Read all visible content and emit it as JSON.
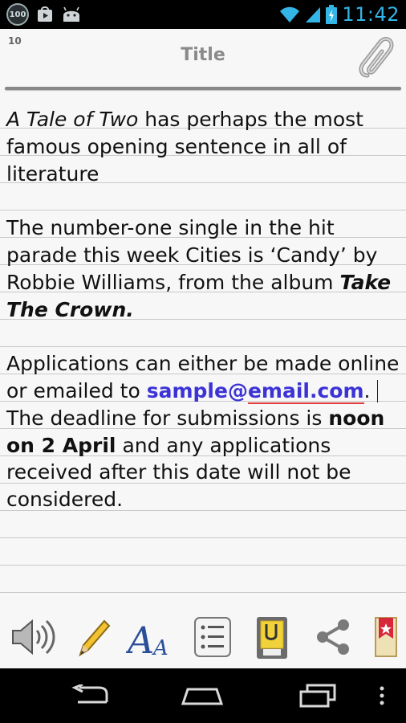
{
  "status_bar": {
    "time": "11:42",
    "notification_badge": "100",
    "icons": [
      "badge-100-icon",
      "play-store-icon",
      "android-icon",
      "wifi-icon",
      "signal-icon",
      "battery-icon"
    ]
  },
  "note": {
    "page_number": "10",
    "title": "Title",
    "attach_icon": "paperclip-icon",
    "paragraph1": {
      "italic": "A Tale of Two",
      "rest": " has perhaps the most famous opening sentence in all of literature"
    },
    "paragraph2": {
      "text": "The number-one single in the hit parade this week Cities is ‘Candy’ by Robbie Williams, from the album ",
      "bold_italic": "Take The Crown",
      "end": "."
    },
    "paragraph3": {
      "text1": "Applications can either be made online or emailed to ",
      "link_user": "sample@",
      "link_domain": "email.com",
      "text2": ". ",
      "text3": "The deadline for submissions is ",
      "bold": "noon on 2 April",
      "text4": " and any applications received after this date will not be considered."
    }
  },
  "toolbar": {
    "tools": [
      "speaker-icon",
      "pencil-icon",
      "font-icon",
      "list-icon",
      "clipboard-icon",
      "share-icon",
      "bookmark-icon"
    ]
  },
  "nav_bar": {
    "icons": [
      "back-icon",
      "home-icon",
      "recents-icon",
      "menu-icon"
    ]
  },
  "colors": {
    "accent_time": "#33b5e5",
    "link": "#3b33d6",
    "spellcheck": "#e03c3c",
    "paper": "#f7f7f7"
  }
}
